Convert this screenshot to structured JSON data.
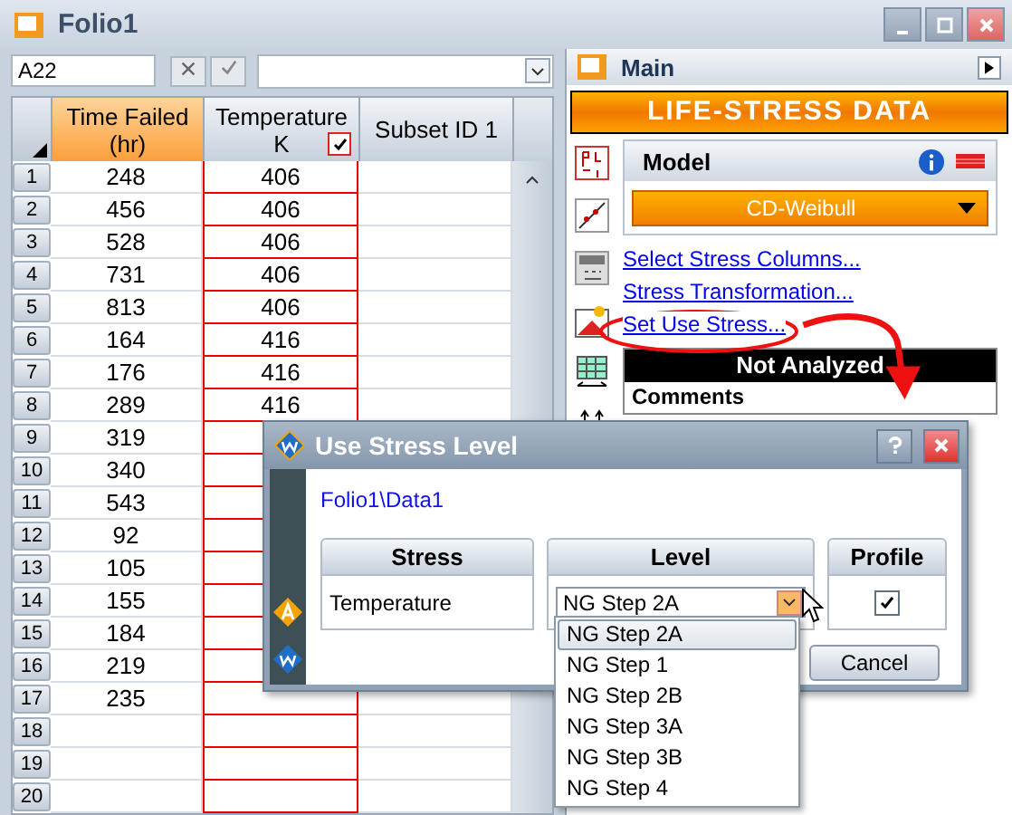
{
  "window": {
    "title": "Folio1"
  },
  "toolbar": {
    "cell_ref": "A22"
  },
  "grid": {
    "columns": [
      {
        "label": "Time Failed (hr)",
        "selected": true
      },
      {
        "label": "Temperature K",
        "selected": false,
        "checked": true
      },
      {
        "label": "Subset ID 1",
        "selected": false
      }
    ],
    "rows": [
      {
        "number": "1",
        "time": "248",
        "temperature": "406"
      },
      {
        "number": "2",
        "time": "456",
        "temperature": "406"
      },
      {
        "number": "3",
        "time": "528",
        "temperature": "406"
      },
      {
        "number": "4",
        "time": "731",
        "temperature": "406"
      },
      {
        "number": "5",
        "time": "813",
        "temperature": "406"
      },
      {
        "number": "6",
        "time": "164",
        "temperature": "416"
      },
      {
        "number": "7",
        "time": "176",
        "temperature": "416"
      },
      {
        "number": "8",
        "time": "289",
        "temperature": "416"
      },
      {
        "number": "9",
        "time": "319"
      },
      {
        "number": "10",
        "time": "340"
      },
      {
        "number": "11",
        "time": "543"
      },
      {
        "number": "12",
        "time": "92"
      },
      {
        "number": "13",
        "time": "105"
      },
      {
        "number": "14",
        "time": "155"
      },
      {
        "number": "15",
        "time": "184"
      },
      {
        "number": "16",
        "time": "219"
      },
      {
        "number": "17",
        "time": "235"
      },
      {
        "number": "18"
      },
      {
        "number": "19"
      },
      {
        "number": "20"
      }
    ]
  },
  "panel": {
    "title": "Main",
    "banner": "LIFE-STRESS DATA",
    "model_label": "Model",
    "model_value": "CD-Weibull",
    "links": [
      "Select Stress Columns...",
      "Stress Transformation...",
      "Set Use Stress..."
    ],
    "status": "Not Analyzed",
    "comments": "Comments"
  },
  "dialog": {
    "title": "Use Stress Level",
    "path": "Folio1\\Data1",
    "columns": [
      "Stress",
      "Level",
      "Profile"
    ],
    "rows": [
      {
        "stress": "Temperature",
        "level": "NG Step 2A",
        "profile": true
      }
    ],
    "buttons": [
      "Cancel"
    ],
    "options": [
      {
        "label": "NG Step 2A",
        "selected": true
      },
      {
        "label": "NG Step 1",
        "selected": false
      },
      {
        "label": "NG Step 2B",
        "selected": false
      },
      {
        "label": "NG Step 3A",
        "selected": false
      },
      {
        "label": "NG Step 3B",
        "selected": false
      },
      {
        "label": "NG Step 4",
        "selected": false
      }
    ]
  }
}
